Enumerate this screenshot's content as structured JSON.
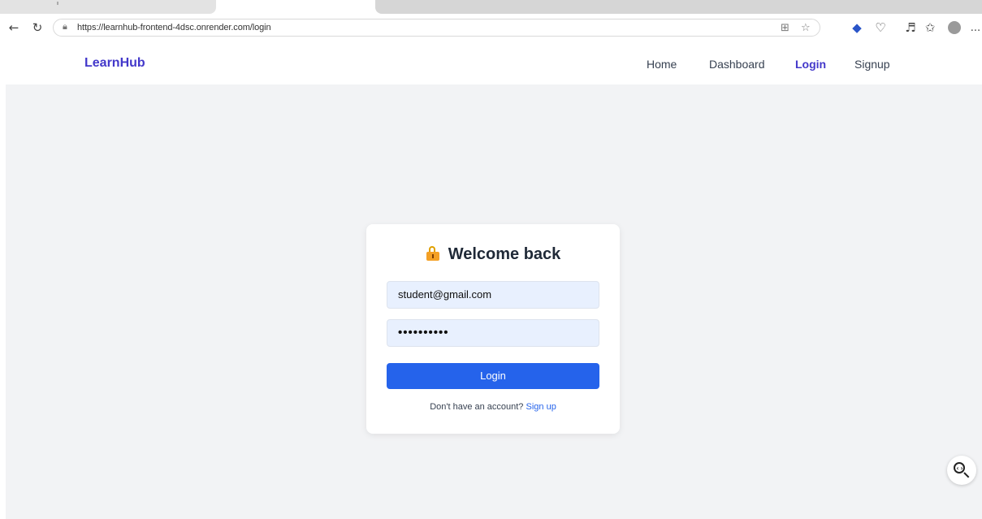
{
  "browser": {
    "url": "https://learnhub-frontend-4dsc.onrender.com/login",
    "more_label": "..."
  },
  "navbar": {
    "brand": "LearnHub",
    "links": [
      "Home",
      "Dashboard",
      "Login",
      "Signup"
    ],
    "active_link": "Login",
    "accent_color": "#4338ca"
  },
  "login_card": {
    "title": "Welcome back",
    "icon": "lock-icon",
    "email_value": "student@gmail.com",
    "password_value": "••••••••••",
    "button_label": "Login",
    "signup_prompt": "Don't have an account?",
    "signup_link": "Sign up",
    "button_color": "#2563eb"
  }
}
